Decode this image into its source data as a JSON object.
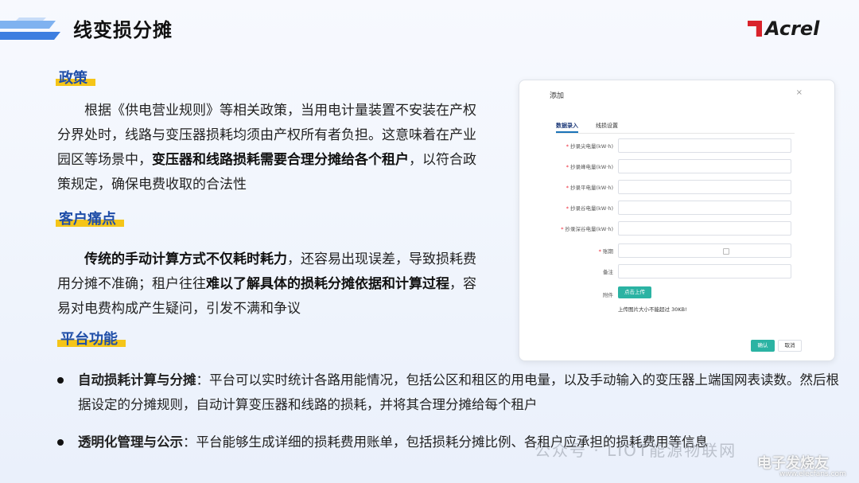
{
  "header": {
    "title": "线变损分摊",
    "logo_text": "Acrel",
    "accent_color": "#d9232b"
  },
  "sections": {
    "policy": {
      "tag": "政策",
      "text_1": "根据《供电营业规则》等相关政策，当用电计量装置不安装在产权分界处时，线路与变压器损耗均须由产权所有者负担。这意味着在产业园区等场景中，",
      "bold_1": "变压器和线路损耗需要合理分摊给各个租户",
      "text_2": "，以符合政策规定，确保电费收取的合法性"
    },
    "pain": {
      "tag": "客户痛点",
      "bold_1": "传统的手动计算方式不仅耗时耗力",
      "text_1": "，还容易出现误差，导致损耗费用分摊不准确；租户往往",
      "bold_2": "难以了解具体的损耗分摊依据和计算过程",
      "text_2": "，容易对电费构成产生疑问，引发不满和争议"
    },
    "platform": {
      "tag": "平台功能",
      "bullets": [
        {
          "bold": "自动损耗计算与分摊",
          "text": "：平台可以实时统计各路用能情况，包括公区和租区的用电量，以及手动输入的变压器上端国网表读数。然后根据设定的分摊规则，自动计算变压器和线路的损耗，并将其合理分摊给每个租户"
        },
        {
          "bold": "透明化管理与公示",
          "text": "：平台能够生成详细的损耗费用账单，包括损耗分摊比例、各租户应承担的损耗费用等信息"
        }
      ]
    }
  },
  "dialog": {
    "title": "添加",
    "close": "×",
    "tabs": [
      "数据录入",
      "线损设置"
    ],
    "fields": [
      {
        "label": "抄录尖电量(kW·h)",
        "required": true
      },
      {
        "label": "抄录峰电量(kW·h)",
        "required": true
      },
      {
        "label": "抄录平电量(kW·h)",
        "required": true
      },
      {
        "label": "抄录谷电量(kW·h)",
        "required": true
      },
      {
        "label": "抄录深谷电量(kW·h)",
        "required": true
      }
    ],
    "period_label": "账期",
    "remark_label": "备注",
    "attach_label": "附件",
    "upload_button": "点击上传",
    "upload_hint": "上传图片大小不能超过 30KB!",
    "confirm_button": "确认",
    "cancel_button": "取消",
    "accent_color": "#2bb3a3"
  },
  "watermark": {
    "text": "公众号 · LIOT能源物联网",
    "site": "电子发烧友",
    "url": "www.elecfans.com"
  }
}
